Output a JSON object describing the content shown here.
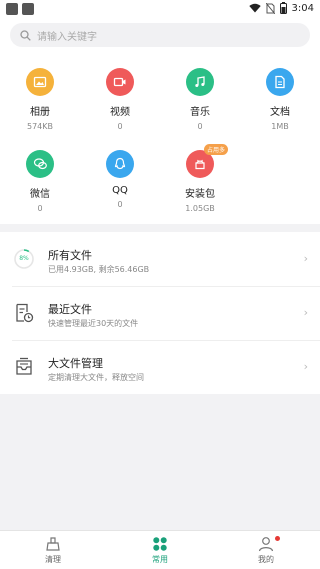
{
  "status_bar": {
    "time": "3:04"
  },
  "search": {
    "placeholder": "请输入关键字"
  },
  "categories": [
    {
      "name": "相册",
      "sub": "574KB",
      "color": "#f5b23b",
      "icon": "image-icon"
    },
    {
      "name": "视频",
      "sub": "0",
      "color": "#ef5a5a",
      "icon": "video-icon"
    },
    {
      "name": "音乐",
      "sub": "0",
      "color": "#2bbf86",
      "icon": "music-icon"
    },
    {
      "name": "文档",
      "sub": "1MB",
      "color": "#3aa7ee",
      "icon": "document-icon"
    },
    {
      "name": "微信",
      "sub": "0",
      "color": "#2bbf86",
      "icon": "wechat-icon"
    },
    {
      "name": "QQ",
      "sub": "0",
      "color": "#3aa7ee",
      "icon": "qq-icon"
    },
    {
      "name": "安装包",
      "sub": "1.05GB",
      "color": "#ef5a5a",
      "icon": "apk-icon",
      "badge": "占用多"
    }
  ],
  "file_list": [
    {
      "title": "所有文件",
      "desc": "已用4.93GB, 剩余56.46GB",
      "usage_percent": "8%",
      "icon": "usage-ring-icon"
    },
    {
      "title": "最近文件",
      "desc": "快速管理最近30天的文件",
      "icon": "recent-files-icon"
    },
    {
      "title": "大文件管理",
      "desc": "定期清理大文件，释放空间",
      "icon": "large-files-icon"
    }
  ],
  "tabs": [
    {
      "label": "清理",
      "icon": "broom-icon",
      "active": false
    },
    {
      "label": "常用",
      "icon": "grid-icon",
      "active": true
    },
    {
      "label": "我的",
      "icon": "user-icon",
      "active": false
    }
  ],
  "colors": {
    "accent": "#1aa07a",
    "notify_dot": "#e53935"
  }
}
